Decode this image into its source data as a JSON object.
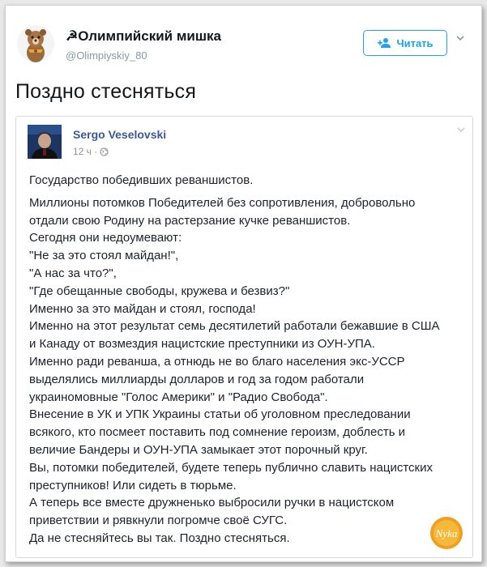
{
  "tweet": {
    "author_name": "☭Олимпийский мишка",
    "author_handle": "@Olimpiyskiy_80",
    "follow_label": "Читать",
    "text": "Поздно стесняться",
    "icons": {
      "follow": "add-user-icon",
      "menu": "chevron-down-icon"
    }
  },
  "quoted_post": {
    "author_name": "Sergo Veselovski",
    "time": "12 ч ·",
    "privacy_icon": "globe-icon",
    "first_line": "Государство победивших реваншистов.",
    "lines": [
      "Миллионы потомков Победителей без сопротивления, добровольно",
      "отдали свою Родину на растерзание кучке реваншистов.",
      "Сегодня они недоумевают:",
      "\"Не за это стоял майдан!\",",
      "\"А нас за что?\",",
      "\"Где обещанные свободы, кружева и безвиз?\"",
      "Именно за это майдан и стоял, господа!",
      "Именно на этот результат семь десятилетий работали бежавшие в США",
      "и Канаду от возмездия нацистские преступники из ОУН-УПА.",
      "Именно ради реванша, а отнюдь не во благо населения экс-УССР",
      "выделялись миллиарды долларов и год за годом работали",
      "украиномовные \"Голос Америки\" и \"Радио Свобода\".",
      "Внесение в УК и УПК Украины статьи об уголовном преследовании",
      "всякого, кто посмеет поставить под сомнение героизм, доблесть и",
      "величие Бандеры и ОУН-УПА замыкает этот порочный круг.",
      "Вы, потомки победителей, будете теперь публично славить нацистских",
      "преступников! Или сидеть в тюрьме.",
      "А теперь все вместе дружненько выбросили ручки в нацистском",
      "приветствии и рявкнули погромче своё СУГС.",
      "Да не стесняйтесь вы так. Поздно стесняться."
    ]
  },
  "watermark_text": "Nyka",
  "colors": {
    "twitter_blue": "#1da1f2",
    "facebook_blue": "#3b5998",
    "text": "#14171a",
    "muted": "#8899a6"
  }
}
